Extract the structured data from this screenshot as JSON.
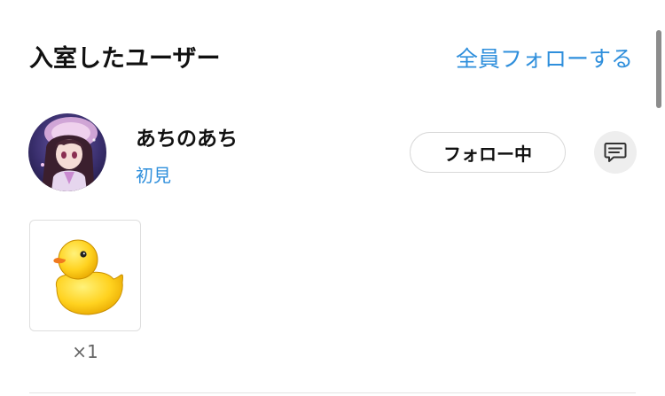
{
  "header": {
    "title": "入室したユーザー",
    "follow_all_label": "全員フォローする"
  },
  "user": {
    "name": "あちのあち",
    "status": "初見",
    "follow_button_label": "フォロー中",
    "avatar_icon": "user-avatar"
  },
  "gifts": [
    {
      "icon": "rubber-duck-icon",
      "count_label": "×1"
    }
  ],
  "colors": {
    "accent": "#2f8fdc",
    "button_border": "#d9d9d9",
    "message_button_bg": "#eeeeee"
  }
}
